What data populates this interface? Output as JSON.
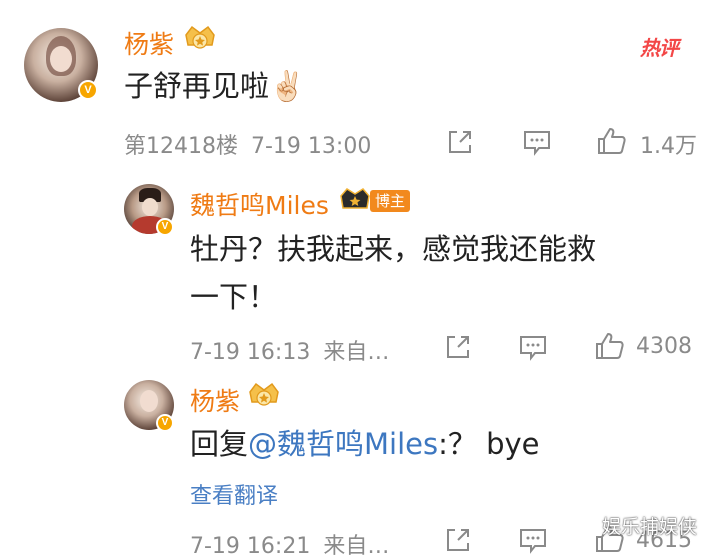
{
  "comment": {
    "author": "杨紫",
    "text": "子舒再见啦✌🏻",
    "floor": "第12418楼",
    "time": "7-19 13:00",
    "likes": "1.4万",
    "hot_label": "热评",
    "verified_badge": "V"
  },
  "replies": [
    {
      "author": "魏哲鸣Miles",
      "tag": "博主",
      "text_line1": "牡丹？扶我起来，感觉我还能救",
      "text_line2": "一下！",
      "time": "7-19 16:13",
      "source": "来自…",
      "likes": "4308",
      "verified_badge": "V"
    },
    {
      "author": "杨紫",
      "reply_prefix": "回复",
      "mention": "@魏哲鸣Miles",
      "reply_suffix": ":？ bye",
      "translate": "查看翻译",
      "time": "7-19 16:21",
      "source": "来自…",
      "likes": "4615",
      "verified_badge": "V"
    }
  ],
  "watermark": "娱乐捕娱侠",
  "icons": [
    "share-icon",
    "comment-icon",
    "like-icon",
    "crown-icon"
  ],
  "colors": {
    "name": "#ef7b14",
    "mention": "#3d77c0",
    "hot": "#f34747",
    "meta": "#8a8a8a"
  }
}
